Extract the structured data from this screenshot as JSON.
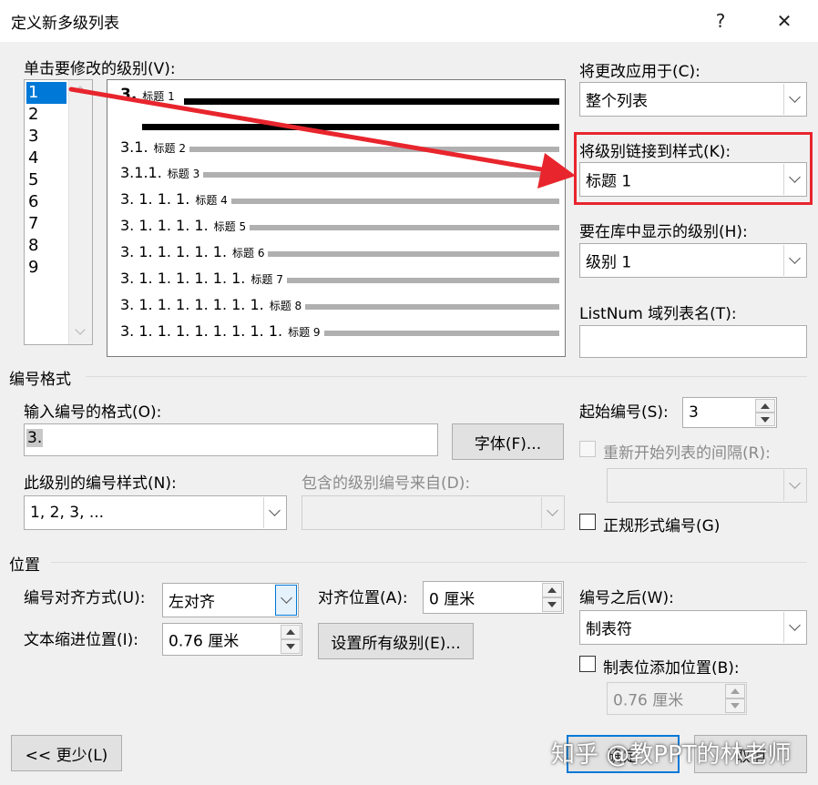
{
  "window": {
    "title": "定义新多级列表",
    "help_label": "?",
    "close_label": "✕"
  },
  "level_picker": {
    "label": "单击要修改的级别(V):",
    "levels": [
      "1",
      "2",
      "3",
      "4",
      "5",
      "6",
      "7",
      "8",
      "9"
    ],
    "selected": "1"
  },
  "preview": {
    "rows": [
      {
        "num": "3.",
        "style": "标题 1"
      },
      {
        "num": "3.1.",
        "style": "标题 2"
      },
      {
        "num": "3.1.1.",
        "style": "标题 3"
      },
      {
        "num": "3. 1. 1. 1.",
        "style": "标题 4"
      },
      {
        "num": "3. 1. 1. 1. 1.",
        "style": "标题 5"
      },
      {
        "num": "3. 1. 1. 1. 1. 1.",
        "style": "标题 6"
      },
      {
        "num": "3. 1. 1. 1. 1. 1. 1.",
        "style": "标题 7"
      },
      {
        "num": "3. 1. 1. 1. 1. 1. 1. 1.",
        "style": "标题 8"
      },
      {
        "num": "3. 1. 1. 1. 1. 1. 1. 1. 1.",
        "style": "标题 9"
      }
    ]
  },
  "apply_to": {
    "label": "将更改应用于(C):",
    "value": "整个列表"
  },
  "link_style": {
    "label": "将级别链接到样式(K):",
    "value": "标题 1"
  },
  "gallery_level": {
    "label": "要在库中显示的级别(H):",
    "value": "级别 1"
  },
  "listnum": {
    "label": "ListNum 域列表名(T):",
    "value": ""
  },
  "number_format": {
    "section_label": "编号格式",
    "format_label": "输入编号的格式(O):",
    "format_value": "3.",
    "font_button": "字体(F)...",
    "style_label": "此级别的编号样式(N):",
    "style_value": "1, 2, 3, ...",
    "include_label": "包含的级别编号来自(D):",
    "include_value": "",
    "start_label": "起始编号(S):",
    "start_value": "3",
    "restart_label": "重新开始列表的间隔(R):",
    "restart_value": "",
    "legal_label": "正规形式编号(G)"
  },
  "position": {
    "section_label": "位置",
    "align_label": "编号对齐方式(U):",
    "align_value": "左对齐",
    "align_at_label": "对齐位置(A):",
    "align_at_value": "0 厘米",
    "indent_label": "文本缩进位置(I):",
    "indent_value": "0.76 厘米",
    "set_all_button": "设置所有级别(E)...",
    "follow_label": "编号之后(W):",
    "follow_value": "制表符",
    "tab_stop_label": "制表位添加位置(B):",
    "tab_stop_value": "0.76 厘米"
  },
  "footer": {
    "less_button": "<< 更少(L)",
    "ok_button": "确定",
    "cancel_button": "取消"
  },
  "watermark": "知乎 @教PPT的林老师",
  "colors": {
    "highlight": "#e8252d",
    "selection": "#0078d7"
  }
}
